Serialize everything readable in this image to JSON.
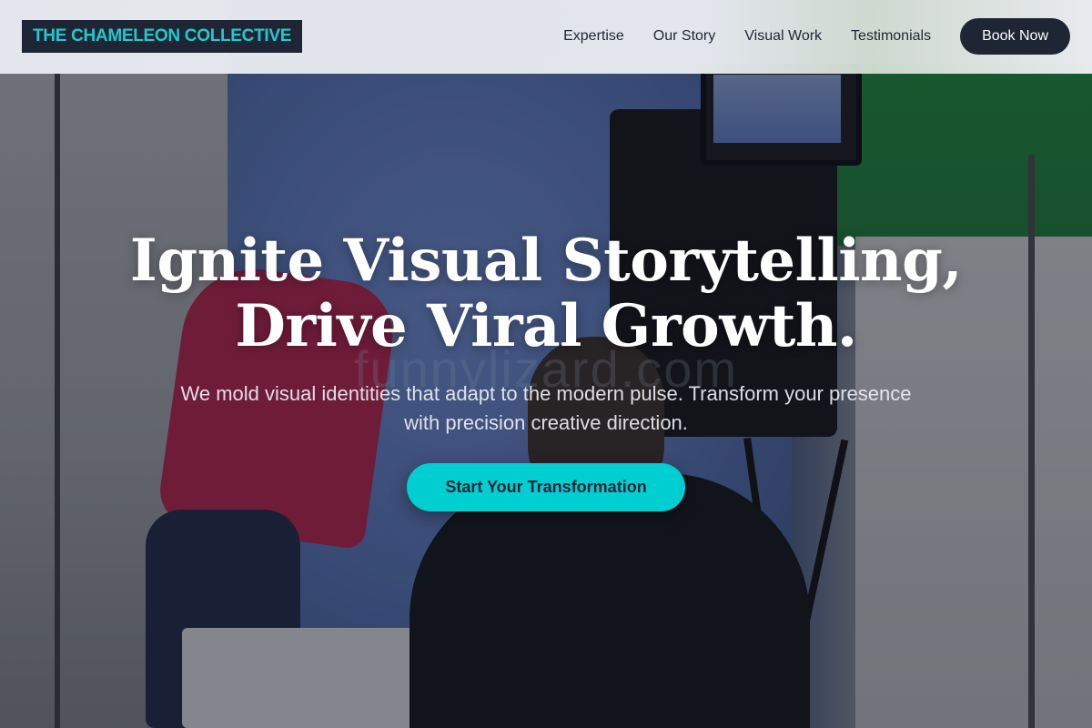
{
  "header": {
    "logo_text": "THE CHAMELEON COLLECTIVE",
    "nav": [
      {
        "label": "Expertise"
      },
      {
        "label": "Our Story"
      },
      {
        "label": "Visual Work"
      },
      {
        "label": "Testimonials"
      }
    ],
    "book_label": "Book Now"
  },
  "hero": {
    "title_line1": "Ignite Visual Storytelling,",
    "title_line2": "Drive Viral Growth.",
    "watermark": "funnylizard.com",
    "subtitle": "We mold visual identities that adapt to the modern pulse. Transform your presence with precision creative direction.",
    "cta_label": "Start Your Transformation"
  },
  "colors": {
    "brand_dark": "#1e2535",
    "accent_teal": "#00ced1",
    "logo_text": "#22c8cf"
  }
}
